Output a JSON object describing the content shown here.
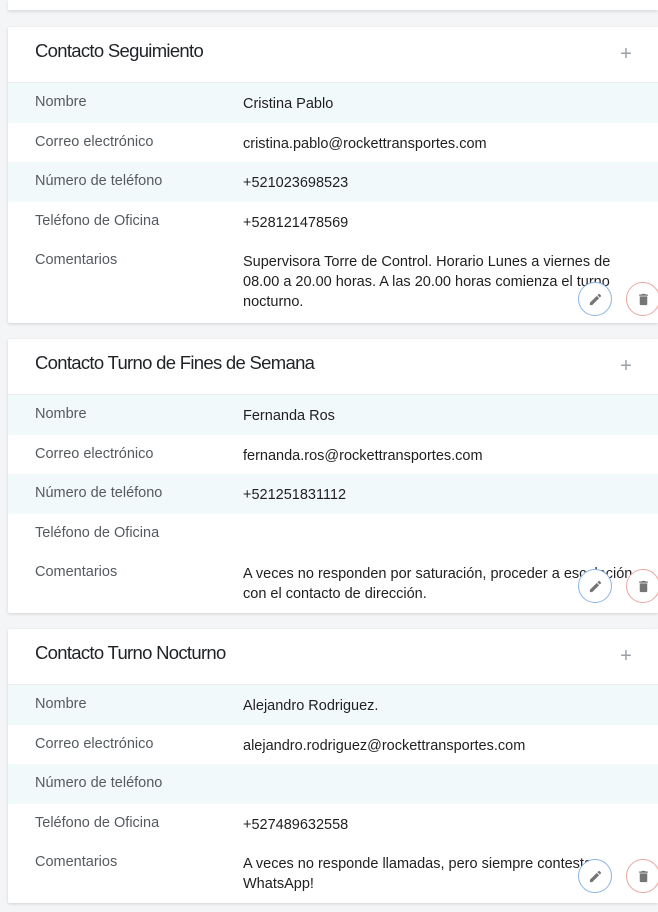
{
  "contacts": [
    {
      "title": "Contacto Seguimiento",
      "fields": {
        "nombre_label": "Nombre",
        "nombre": "Cristina Pablo",
        "correo_label": "Correo electrónico",
        "correo": "cristina.pablo@rockettransportes.com",
        "telefono_label": "Número de teléfono",
        "telefono": "+521023698523",
        "oficina_label": "Teléfono de Oficina",
        "oficina": "+528121478569",
        "comentarios_label": "Comentarios",
        "comentarios": "Supervisora Torre de Control. Horario Lunes a viernes de 08.00 a 20.00 horas. A las 20.00 horas comienza el turno nocturno."
      }
    },
    {
      "title": "Contacto Turno de Fines de Semana",
      "fields": {
        "nombre_label": "Nombre",
        "nombre": "Fernanda Ros",
        "correo_label": "Correo electrónico",
        "correo": "fernanda.ros@rockettransportes.com",
        "telefono_label": "Número de teléfono",
        "telefono": "+521251831112",
        "oficina_label": "Teléfono de Oficina",
        "oficina": "",
        "comentarios_label": "Comentarios",
        "comentarios": "A veces no responden por saturación, proceder a escalación con el contacto de dirección."
      }
    },
    {
      "title": "Contacto Turno Nocturno",
      "fields": {
        "nombre_label": "Nombre",
        "nombre": "Alejandro Rodriguez.",
        "correo_label": "Correo electrónico",
        "correo": "alejandro.rodriguez@rockettransportes.com",
        "telefono_label": "Número de teléfono",
        "telefono": "",
        "oficina_label": "Teléfono de Oficina",
        "oficina": "+527489632558",
        "comentarios_label": "Comentarios",
        "comentarios": "A veces no responde llamadas, pero siempre contesta WhatsApp!"
      }
    }
  ],
  "icons": {
    "add": "plus-icon",
    "edit": "pencil-icon",
    "delete": "trash-icon"
  },
  "colors": {
    "row_shade": "#f2f9fb",
    "edit_border": "#8ab4e6",
    "delete_border": "#e8a7a2",
    "icon_gray": "#757575"
  }
}
